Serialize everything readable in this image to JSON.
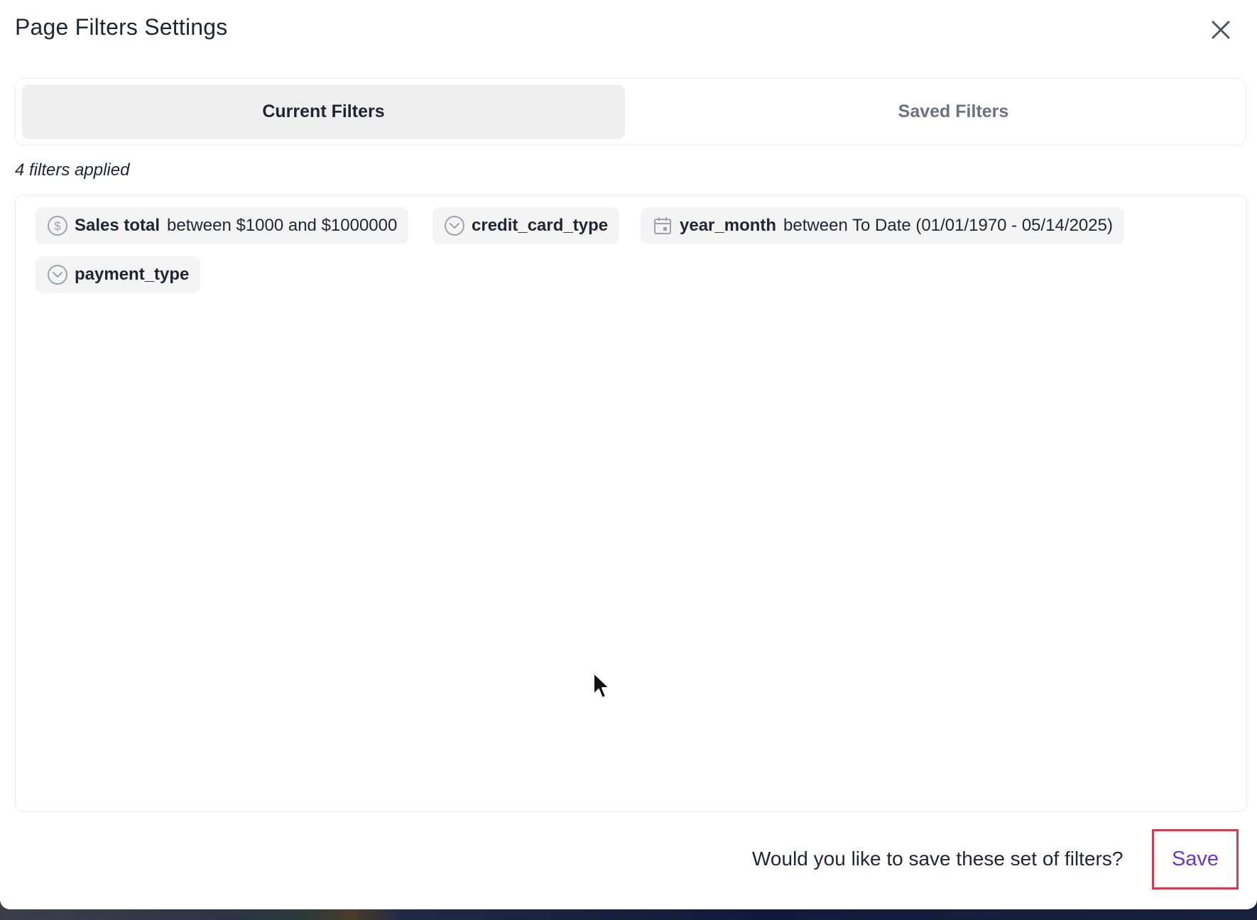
{
  "modal": {
    "title": "Page Filters Settings",
    "close_icon": "close-icon"
  },
  "tabs": [
    {
      "label": "Current Filters",
      "active": true
    },
    {
      "label": "Saved Filters",
      "active": false
    }
  ],
  "applied_count_text": "4 filters applied",
  "filters": [
    {
      "icon": "dollar-circle-icon",
      "field": "Sales total",
      "condition": "between $1000 and $1000000"
    },
    {
      "icon": "chevron-circle-icon",
      "field": "credit_card_type",
      "condition": ""
    },
    {
      "icon": "calendar-icon",
      "field": "year_month",
      "condition": "between To Date (01/01/1970 - 05/14/2025)"
    },
    {
      "icon": "chevron-circle-icon",
      "field": "payment_type",
      "condition": ""
    }
  ],
  "footer": {
    "question": "Would you like to save these set of filters?",
    "save_label": "Save"
  },
  "colors": {
    "accent": "#6b35d6",
    "highlight_border": "#d63a4e",
    "active_tab_bg": "#efefef",
    "chip_bg": "#f4f4f5"
  }
}
